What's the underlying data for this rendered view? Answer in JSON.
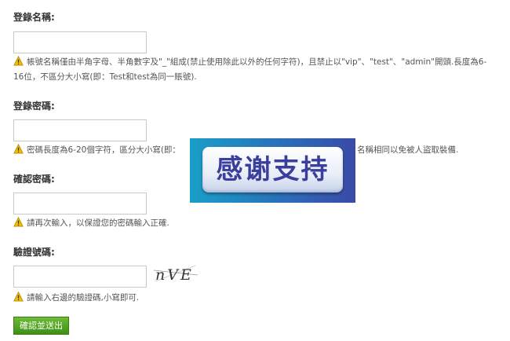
{
  "form": {
    "username": {
      "label": "登錄名稱:",
      "value": "",
      "hint_line1": "帳號名稱僅由半角字母、半角數字及\"_\"組成(禁止使用除此以外的任何字符)，且禁止以\"vip\"、\"test\"、\"admin\"開頭.長度為6-",
      "hint_line2": "16位，不區分大小寫(即：Test和test為同一賬號)."
    },
    "password": {
      "label": "登錄密碼:",
      "value": "",
      "hint_visible_left": "密碼長度為6-20個字符，區分大小寫(即：",
      "hint_visible_right": "名稱相同以免被人盜取裝備."
    },
    "confirm_password": {
      "label": "確認密碼:",
      "value": "",
      "hint": "請再次輸入，以保證您的密碼輸入正確."
    },
    "captcha": {
      "label": "驗證號碼:",
      "value": "",
      "image_text": "nVE",
      "hint": "請輸入右邊的驗證碼,小寫即可."
    },
    "submit_label": "確認並送出"
  },
  "overlay": {
    "text": "感谢支持"
  },
  "colors": {
    "submit_bg": "#4a9a1e",
    "warning_icon": "#f2c200",
    "overlay_text": "#3a3f9e"
  },
  "icons": {
    "warning": "warning-icon"
  }
}
